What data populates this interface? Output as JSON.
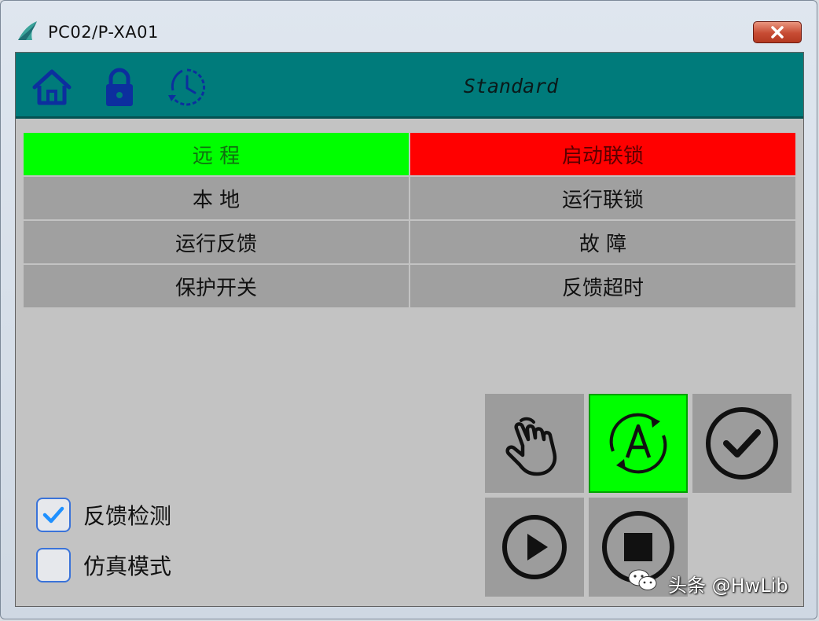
{
  "window": {
    "title": "PC02/P-XA01"
  },
  "header": {
    "mode": "Standard"
  },
  "status_grid": [
    [
      {
        "label": "远 程",
        "state": "active-green"
      },
      {
        "label": "启动联锁",
        "state": "alarm-red"
      }
    ],
    [
      {
        "label": "本 地",
        "state": "off"
      },
      {
        "label": "运行联锁",
        "state": "off"
      }
    ],
    [
      {
        "label": "运行反馈",
        "state": "off"
      },
      {
        "label": "故 障",
        "state": "off"
      }
    ],
    [
      {
        "label": "保护开关",
        "state": "off"
      },
      {
        "label": "反馈超时",
        "state": "off"
      }
    ]
  ],
  "checkboxes": [
    {
      "label": "反馈检测",
      "checked": true
    },
    {
      "label": "仿真模式",
      "checked": false
    }
  ],
  "controls": {
    "manual": "hand-icon",
    "auto": "auto-mode-icon",
    "confirm": "check-icon",
    "start": "play-icon",
    "stop": "stop-icon",
    "auto_active": true
  },
  "watermark": {
    "text": "头条 @HwLib",
    "icon": "wechat-icon"
  },
  "colors": {
    "header": "#007b7b",
    "active": "#00ff00",
    "alarm": "#ff0000",
    "panel": "#c3c3c3",
    "cell": "#a0a0a0"
  }
}
